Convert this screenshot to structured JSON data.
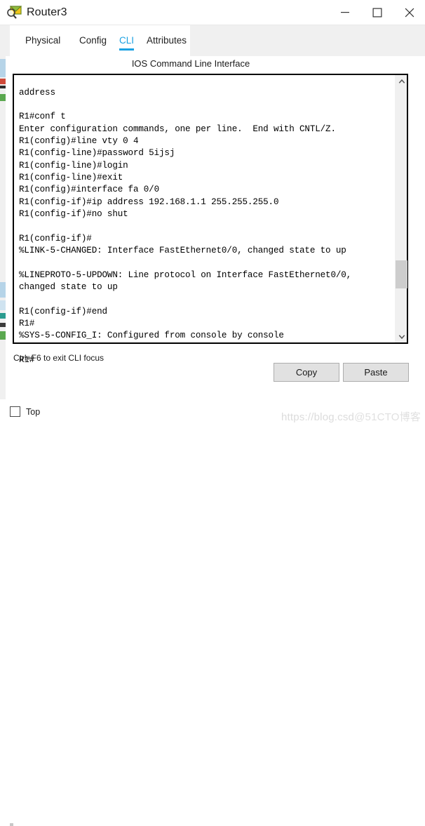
{
  "window": {
    "title": "Router3",
    "icon": "router-device-icon",
    "controls": {
      "minimize": "minimize-icon",
      "maximize": "maximize-icon",
      "close": "close-icon"
    }
  },
  "tabs": [
    {
      "label": "Physical",
      "active": false
    },
    {
      "label": "Config",
      "active": false
    },
    {
      "label": "CLI",
      "active": true
    },
    {
      "label": "Attributes",
      "active": false
    }
  ],
  "panel": {
    "heading": "IOS Command Line Interface"
  },
  "terminal": {
    "lines": [
      "address",
      "",
      "R1#conf t",
      "Enter configuration commands, one per line.  End with CNTL/Z.",
      "R1(config)#line vty 0 4",
      "R1(config-line)#password 5ijsj",
      "R1(config-line)#login",
      "R1(config-line)#exit",
      "R1(config)#interface fa 0/0",
      "R1(config-if)#ip address 192.168.1.1 255.255.255.0",
      "R1(config-if)#no shut",
      "",
      "R1(config-if)#",
      "%LINK-5-CHANGED: Interface FastEthernet0/0, changed state to up",
      "",
      "%LINEPROTO-5-UPDOWN: Line protocol on Interface FastEthernet0/0,",
      "changed state to up",
      "",
      "R1(config-if)#end",
      "R1#",
      "%SYS-5-CONFIG_I: Configured from console by console",
      "",
      "R1#"
    ],
    "text": "address\n\nR1#conf t\nEnter configuration commands, one per line.  End with CNTL/Z.\nR1(config)#line vty 0 4\nR1(config-line)#password 5ijsj\nR1(config-line)#login\nR1(config-line)#exit\nR1(config)#interface fa 0/0\nR1(config-if)#ip address 192.168.1.1 255.255.255.0\nR1(config-if)#no shut\n\nR1(config-if)#\n%LINK-5-CHANGED: Interface FastEthernet0/0, changed state to up\n\n%LINEPROTO-5-UPDOWN: Line protocol on Interface FastEthernet0/0,\nchanged state to up\n\nR1(config-if)#end\nR1#\n%SYS-5-CONFIG_I: Configured from console by console\n\nR1#",
    "scrollbar": {
      "up_arrow": "chevron-up-icon",
      "down_arrow": "chevron-down-icon"
    }
  },
  "footer": {
    "hint": "Ctrl+F6 to exit CLI focus",
    "copy_label": "Copy",
    "paste_label": "Paste"
  },
  "bottom": {
    "top_checkbox_label": "Top",
    "top_checkbox_checked": false,
    "watermark_url": "https://blog.csd",
    "watermark_brand": "@51CTO博客"
  },
  "colors": {
    "accent": "#1ba1e2",
    "window_bg": "#ffffff",
    "tabstrip_bg": "#f0f0f0",
    "button_bg": "#e1e1e1",
    "terminal_border": "#000000",
    "scroll_thumb": "#cdcdcd"
  }
}
